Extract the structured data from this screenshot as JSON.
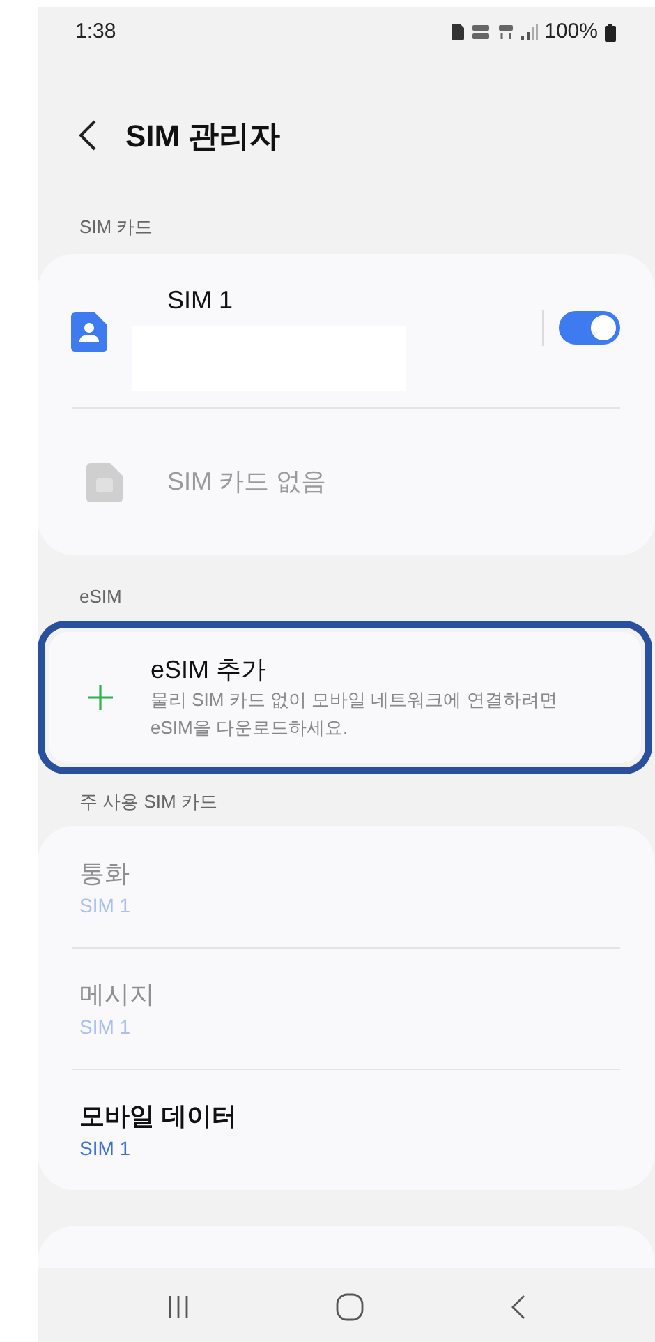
{
  "status_bar": {
    "time": "1:38",
    "battery": "100%"
  },
  "header": {
    "title": "SIM 관리자"
  },
  "sim_section": {
    "label": "SIM 카드",
    "items": [
      {
        "kind": "sim",
        "title": "SIM 1",
        "disabled": false,
        "on": true
      },
      {
        "kind": "empty",
        "title": "SIM 카드 없음",
        "disabled": true
      }
    ]
  },
  "esim_section": {
    "label": "eSIM",
    "add": {
      "title": "eSIM 추가",
      "description": "물리 SIM 카드 없이 모바일 네트워크에 연결하려면 eSIM을 다운로드하세요."
    }
  },
  "primary_section": {
    "label": "주 사용 SIM 카드",
    "items": [
      {
        "title": "통화",
        "value": "SIM 1",
        "disabled": true
      },
      {
        "title": "메시지",
        "value": "SIM 1",
        "disabled": true
      },
      {
        "title": "모바일 데이터",
        "value": "SIM 1",
        "disabled": false
      }
    ]
  }
}
